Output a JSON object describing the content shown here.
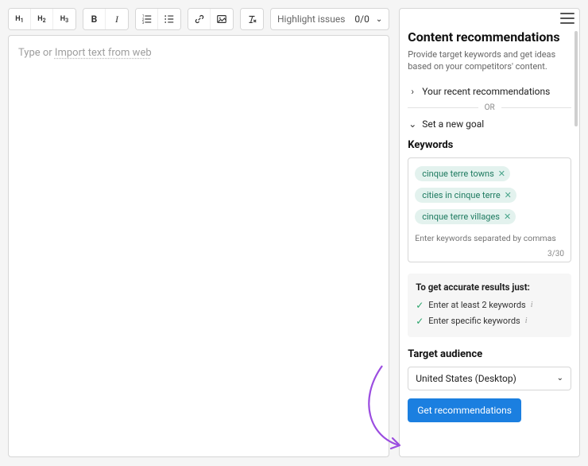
{
  "toolbar": {
    "h1": "H",
    "h1_sub": "1",
    "h2": "H",
    "h2_sub": "2",
    "h3": "H",
    "h3_sub": "3",
    "bold": "B",
    "italic": "I",
    "issues_label": "Highlight issues",
    "issues_count": "0/0"
  },
  "editor": {
    "placeholder_prefix": "Type or ",
    "placeholder_link": "Import text from web"
  },
  "sidebar": {
    "title": "Content recommendations",
    "description": "Provide target keywords and get ideas based on your competitors' content.",
    "recent_label": "Your recent recommendations",
    "or_label": "OR",
    "new_goal_label": "Set a new goal",
    "keywords_label": "Keywords",
    "keywords": [
      "cinque terre towns",
      "cities in cinque terre",
      "cinque terre villages"
    ],
    "keywords_placeholder": "Enter keywords separated by commas",
    "keywords_counter": "3/30",
    "tips_title": "To get accurate results just:",
    "tips": [
      "Enter at least 2 keywords",
      "Enter specific keywords"
    ],
    "audience_label": "Target audience",
    "audience_value": "United States (Desktop)",
    "submit_label": "Get recommendations"
  }
}
